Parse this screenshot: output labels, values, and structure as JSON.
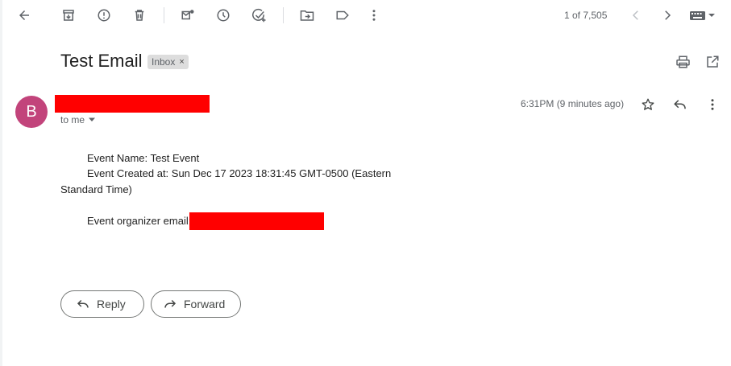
{
  "toolbar": {
    "back_icon": "arrow-left-icon",
    "archive_icon": "archive-icon",
    "spam_icon": "report-spam-icon",
    "delete_icon": "trash-icon",
    "mark_unread_icon": "mark-unread-icon",
    "snooze_icon": "clock-icon",
    "add_task_icon": "add-task-icon",
    "move_icon": "move-to-folder-icon",
    "label_icon": "label-icon",
    "more_icon": "more-vert-icon",
    "pager": "1 of 7,505",
    "input_tools_icon": "keyboard-icon"
  },
  "email": {
    "subject": "Test Email",
    "label_chip": "Inbox",
    "chip_close": "×",
    "sender_initial": "B",
    "recipient": "to me",
    "timestamp": "6:31PM (9 minutes ago)",
    "body": {
      "line1": "Event Name: Test Event",
      "line2": "Event Created at: Sun Dec 17 2023 18:31:45 GMT-0500 (Eastern",
      "line3": "Standard Time)",
      "line4": "Event organizer email:"
    }
  },
  "actions": {
    "reply": "Reply",
    "forward": "Forward"
  },
  "colors": {
    "avatar": "#c2447b",
    "redaction": "#ff0000",
    "chip_bg": "#dddddd",
    "icon": "#5f6368"
  }
}
